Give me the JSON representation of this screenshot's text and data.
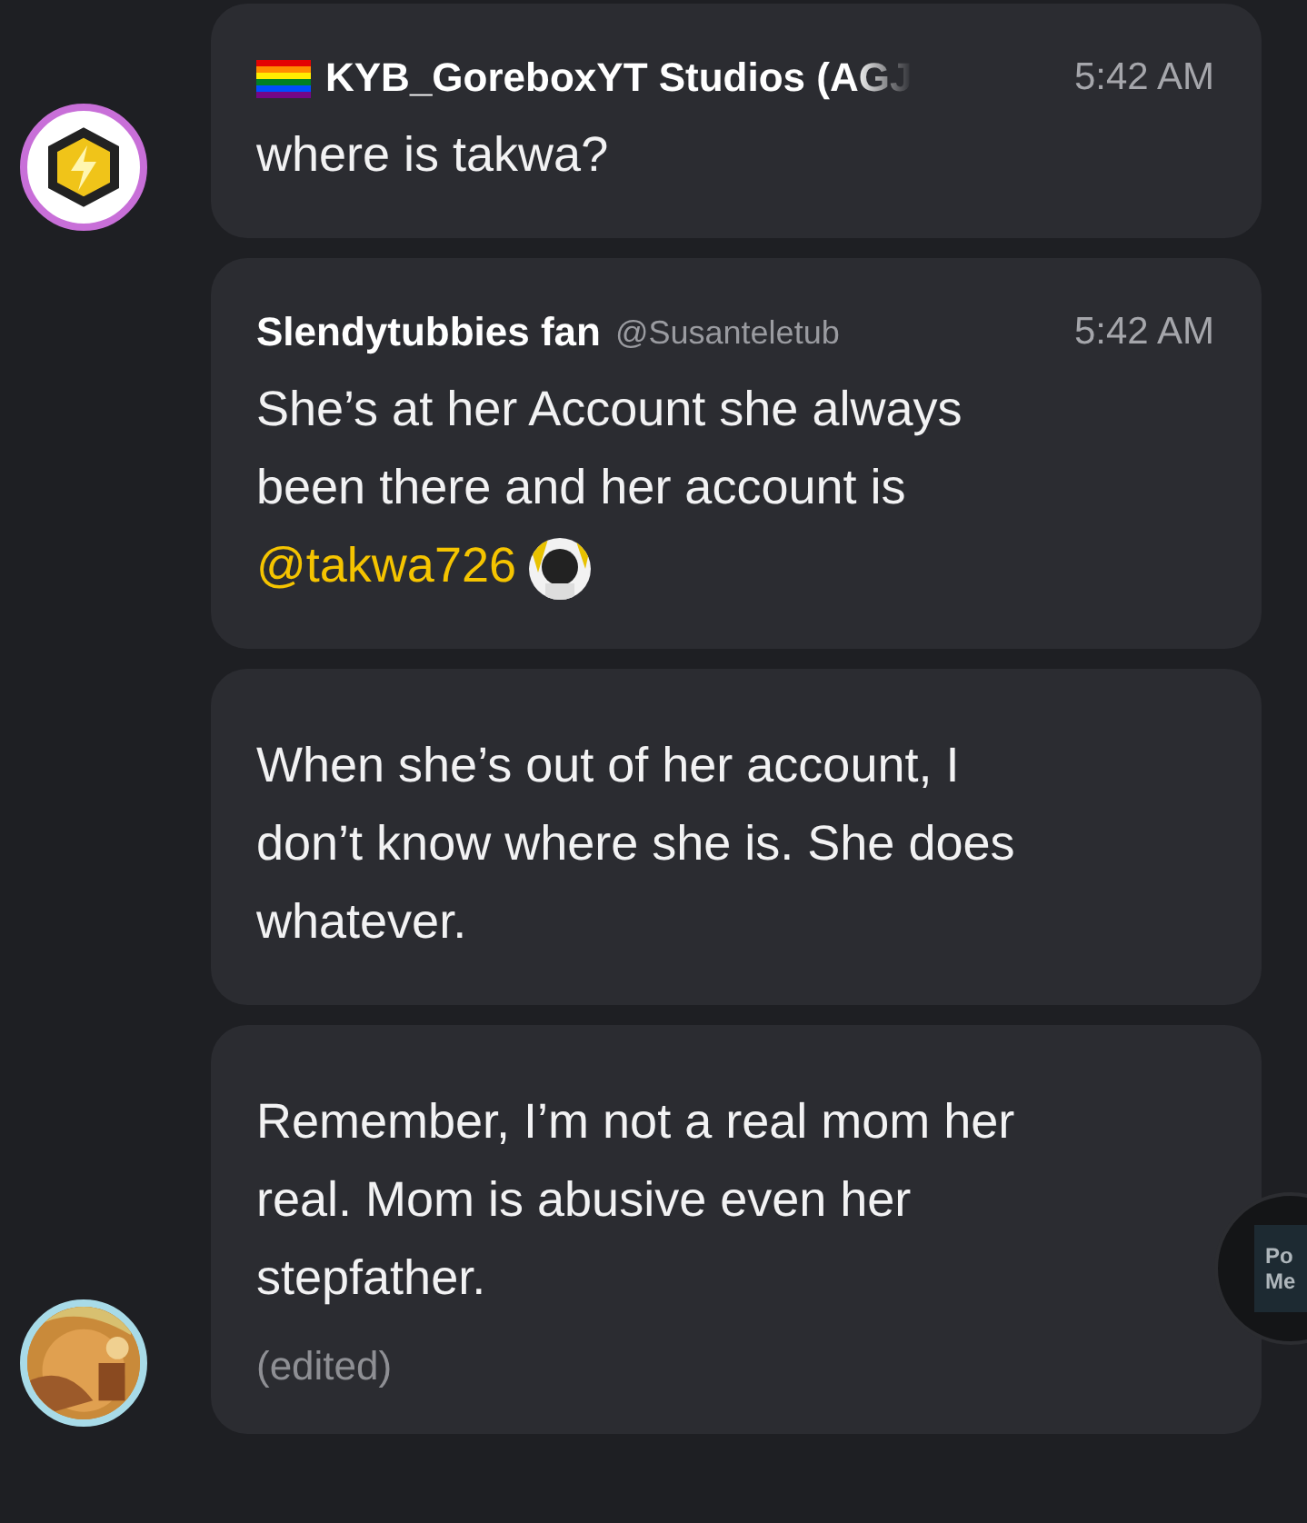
{
  "messages": [
    {
      "avatar": {
        "kind": "badge"
      },
      "author": "KYB_GoreboxYT Studios (AGJ",
      "flag": true,
      "time": "5:42 AM",
      "text": "where is takwa?",
      "edited": false
    },
    {
      "author": "Slendytubbies fan",
      "flag": false,
      "handle": "@Susanteletub",
      "time": "5:42 AM",
      "text": "She’s at her Account she always been there and her account is",
      "mention": "@takwa726",
      "edited": false
    },
    {
      "flag": false,
      "text": "When she’s out of her account, I don’t know where she is. She does whatever.",
      "edited": false
    },
    {
      "flag": false,
      "text": "Remember, I’m not a real mom her real. Mom is abusive even her stepfather.",
      "edited": true,
      "edited_label": "(edited)"
    }
  ],
  "floating_button": {
    "lines": [
      "Po",
      "Me"
    ]
  }
}
